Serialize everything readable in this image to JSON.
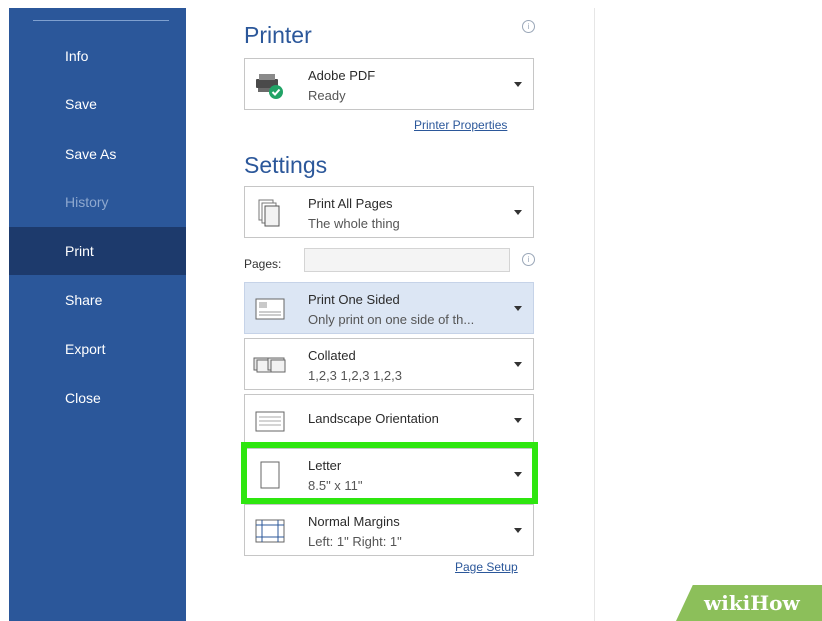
{
  "sidebar": {
    "items": [
      {
        "label": "Info"
      },
      {
        "label": "Save"
      },
      {
        "label": "Save As"
      },
      {
        "label": "History"
      },
      {
        "label": "Print"
      },
      {
        "label": "Share"
      },
      {
        "label": "Export"
      },
      {
        "label": "Close"
      }
    ],
    "active": "Print",
    "disabled": "History",
    "color": "#2b579a",
    "active_color": "#1d3a6c"
  },
  "printer": {
    "title": "Printer",
    "name": "Adobe PDF",
    "status": "Ready",
    "icon": "printer-ready-icon",
    "properties_link": "Printer Properties"
  },
  "settings": {
    "title": "Settings",
    "print_range": {
      "title": "Print All Pages",
      "subtitle": "The whole thing",
      "icon": "pages-icon"
    },
    "pages": {
      "label": "Pages:",
      "value": "",
      "placeholder": ""
    },
    "sides": {
      "title": "Print One Sided",
      "subtitle": "Only print on one side of th...",
      "icon": "one-sided-icon"
    },
    "collation": {
      "title": "Collated",
      "subtitle": "1,2,3   1,2,3   1,2,3",
      "icon": "collated-icon"
    },
    "orientation": {
      "title": "Landscape Orientation",
      "icon": "landscape-icon"
    },
    "paper": {
      "title": "Letter",
      "subtitle": "8.5\" x 11\"",
      "icon": "paper-icon"
    },
    "margins": {
      "title": "Normal Margins",
      "subtitle": "Left:  1\"    Right:  1\"",
      "icon": "margins-icon"
    },
    "page_setup_link": "Page Setup"
  },
  "highlight_color": "#2ee60f",
  "watermark": {
    "part1": "wiki",
    "part2": "How"
  }
}
